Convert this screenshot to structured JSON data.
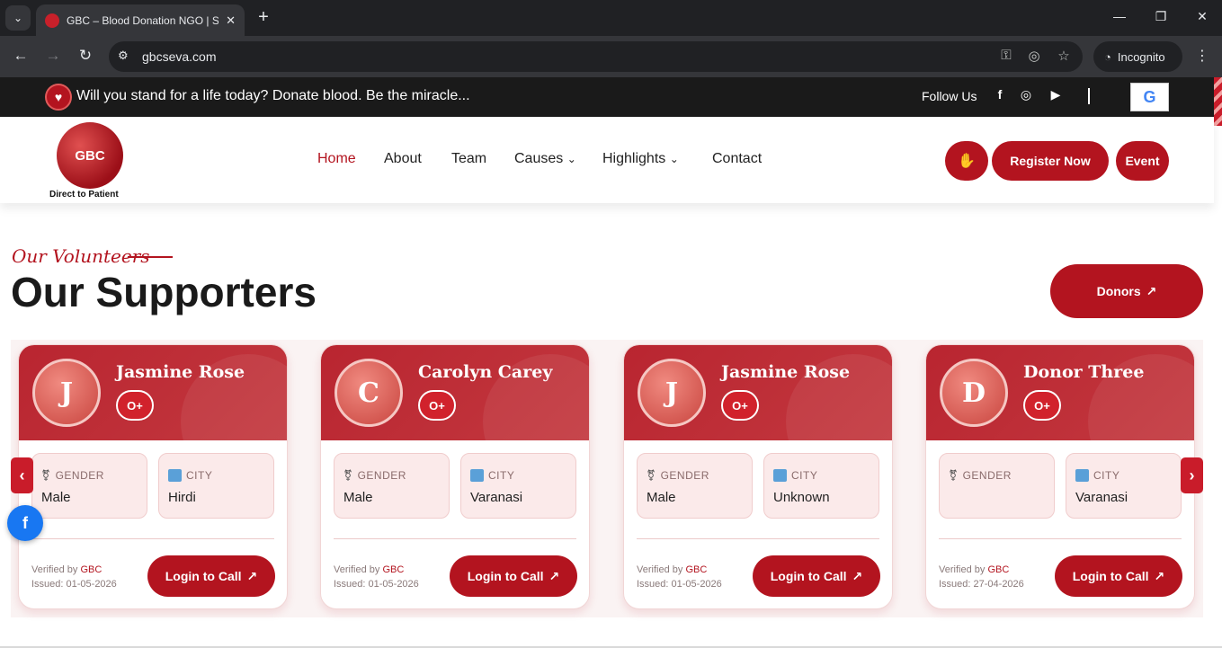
{
  "browser": {
    "tab_title": "GBC – Blood Donation NGO | Sa",
    "tab_close": "✕",
    "new_tab": "+",
    "url": "gbcseva.com",
    "incognito_label": "Incognito",
    "icons": [
      "tab-search-icon",
      "back-icon",
      "forward-icon",
      "reload-icon",
      "site-info-icon",
      "key-icon",
      "eye-off-icon",
      "star-icon",
      "incognito-icon",
      "kebab-icon",
      "minimize-icon",
      "restore-icon",
      "close-icon"
    ]
  },
  "topbar": {
    "tagline": "Will you stand for a life today? Donate blood. Be the miracle...",
    "follow_label": "Follow Us",
    "google_label": "G",
    "social_icons": [
      "facebook-icon",
      "instagram-icon",
      "youtube-icon"
    ]
  },
  "header": {
    "logo_text": "GBC",
    "logo_caption": "Direct to Patient",
    "menu": {
      "home": "Home",
      "about": "About",
      "team": "Team",
      "causes": "Causes",
      "highlights": "Highlights",
      "contact": "Contact"
    },
    "register_label": "Register Now",
    "event_label": "Event"
  },
  "section": {
    "kicker": "Our Volunteers",
    "title": "Our Supporters",
    "donors_label": "Donors"
  },
  "cards": [
    {
      "initial": "J",
      "name": "Jasmine Rose",
      "blood": "O+",
      "gender_label": "GENDER",
      "gender": "Male",
      "city_label": "CITY",
      "city": "Hirdi",
      "verified_prefix": "Verified by",
      "verified_by": "GBC",
      "issued": "Issued: 01-05-2026",
      "call_label": "Login to Call"
    },
    {
      "initial": "C",
      "name": "Carolyn Carey",
      "blood": "O+",
      "gender_label": "GENDER",
      "gender": "Male",
      "city_label": "CITY",
      "city": "Varanasi",
      "verified_prefix": "Verified by",
      "verified_by": "GBC",
      "issued": "Issued: 01-05-2026",
      "call_label": "Login to Call"
    },
    {
      "initial": "J",
      "name": "Jasmine Rose",
      "blood": "O+",
      "gender_label": "GENDER",
      "gender": "Male",
      "city_label": "CITY",
      "city": "Unknown",
      "verified_prefix": "Verified by",
      "verified_by": "GBC",
      "issued": "Issued: 01-05-2026",
      "call_label": "Login to Call"
    },
    {
      "initial": "D",
      "name": "Donor Three",
      "blood": "O+",
      "gender_label": "GENDER",
      "gender": "",
      "city_label": "CITY",
      "city": "Varanasi",
      "verified_prefix": "Verified by",
      "verified_by": "GBC",
      "issued": "Issued: 27-04-2026",
      "call_label": "Login to Call"
    }
  ],
  "colors": {
    "brand": "#b3141f",
    "dark": "#1a1a1a",
    "card_tint": "#fbeaea"
  }
}
